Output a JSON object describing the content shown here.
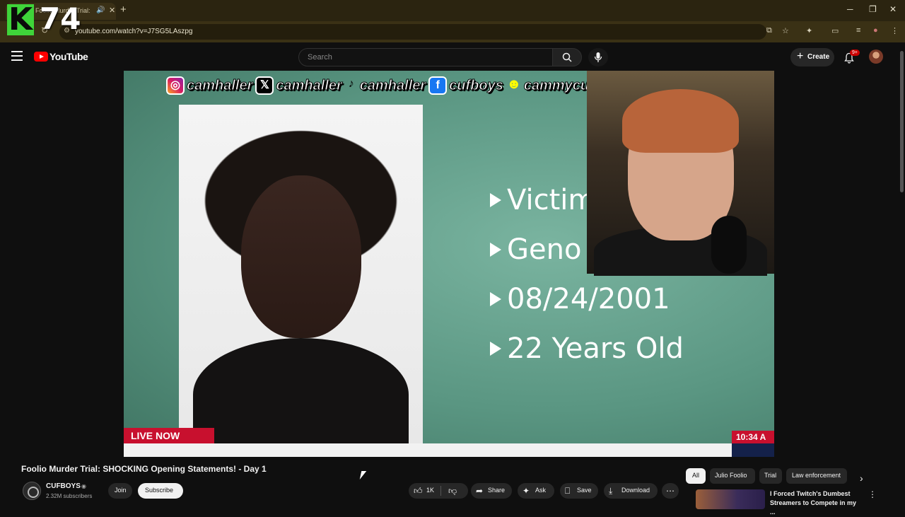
{
  "browser": {
    "tab_title": "Foolio Murder Trial: SH",
    "url": "youtube.com/watch?v=J7SG5LAszpg"
  },
  "overlay_logo": {
    "letter": "K",
    "number": "74"
  },
  "header": {
    "logo_text": "YouTube",
    "search_placeholder": "Search",
    "create_label": "Create",
    "notif_count": "9+"
  },
  "video": {
    "socials": [
      {
        "icon": "instagram-icon",
        "handle": "camhaller"
      },
      {
        "icon": "x-icon",
        "handle": "camhaller"
      },
      {
        "icon": "tiktok-icon",
        "handle": "camhaller"
      },
      {
        "icon": "facebook-icon",
        "handle": "cufboys"
      },
      {
        "icon": "snapchat-icon",
        "handle": "cammycuf"
      }
    ],
    "bullets": [
      "Victim",
      "Geno",
      "08/24/2001",
      "22 Years Old"
    ],
    "live_label": "LIVE NOW",
    "clock": "10:34 A"
  },
  "meta": {
    "title": "Foolio Murder Trial: SHOCKING Opening Statements! - Day 1",
    "channel": "CUFBOYS",
    "subscribers": "2.32M subscribers",
    "join": "Join",
    "subscribe": "Subscribe",
    "likes": "1K",
    "share": "Share",
    "ask": "Ask",
    "save": "Save",
    "download": "Download"
  },
  "chips": [
    "All",
    "Julio Foolio",
    "Trial",
    "Law enforcement"
  ],
  "recommendation": {
    "title": "I Forced Twitch's Dumbest Streamers to Compete in my ..."
  },
  "colors": {
    "accent_red": "#ff0000",
    "live_red": "#c8102e",
    "logo_green": "#3fd43a"
  }
}
